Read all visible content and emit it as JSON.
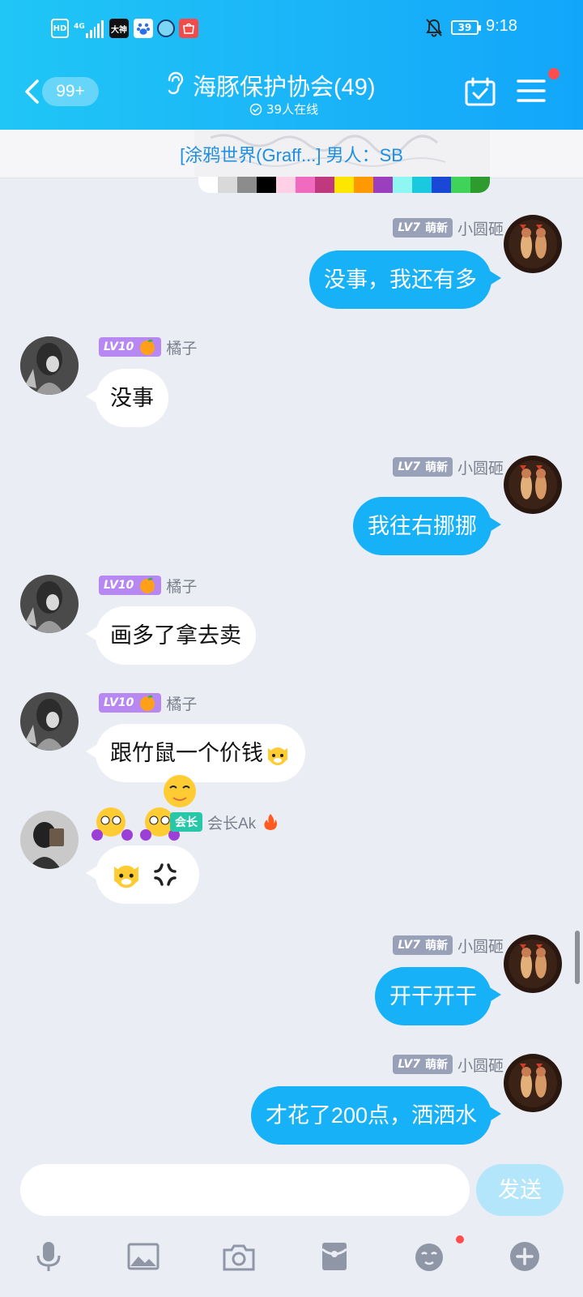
{
  "status_bar": {
    "hd": "HD",
    "network": "4G",
    "app_dashen": "大神",
    "battery": "39",
    "time": "9:18"
  },
  "header": {
    "unread_count": "99+",
    "group_title": "海豚保护协会(49)",
    "online_text": "39人在线"
  },
  "notice": {
    "text": "[涂鸦世界(Graff...] 男人：SB",
    "palette_colors": [
      "#ffffff",
      "#d9d9d9",
      "#8c8c8c",
      "#000000",
      "#ffd0e6",
      "#f06ac0",
      "#c0397f",
      "#ffe600",
      "#ff9900",
      "#9c3fbe",
      "#8ff7f1",
      "#1ac9e0",
      "#1a47d6",
      "#3fd35a",
      "#2e9b2e"
    ]
  },
  "messages": [
    {
      "side": "right",
      "level": "LV7",
      "tag": "萌新",
      "nickname": "小圆砸",
      "text": "没事，我还有多"
    },
    {
      "side": "left",
      "level": "LV10",
      "nickname": "橘子",
      "text": "没事"
    },
    {
      "side": "right",
      "level": "LV7",
      "tag": "萌新",
      "nickname": "小圆砸",
      "text": "我往右挪挪"
    },
    {
      "side": "left",
      "level": "LV10",
      "nickname": "橘子",
      "text": "画多了拿去卖"
    },
    {
      "side": "left",
      "level": "LV10",
      "nickname": "橘子",
      "text": "跟竹鼠一个价钱"
    },
    {
      "side": "left",
      "tag": "会长",
      "nickname": "会长Ak",
      "text": ""
    },
    {
      "side": "right",
      "level": "LV7",
      "tag": "萌新",
      "nickname": "小圆砸",
      "text": "开干开干"
    },
    {
      "side": "right",
      "level": "LV7",
      "tag": "萌新",
      "nickname": "小圆砸",
      "text": "才花了200点，洒洒水"
    }
  ],
  "input": {
    "value": "",
    "send_label": "发送"
  },
  "toolbar_icons": [
    "microphone-icon",
    "image-icon",
    "camera-icon",
    "red-packet-icon",
    "emoji-icon",
    "plus-icon"
  ],
  "colors": {
    "header_gradient_start": "#20c6f6",
    "header_gradient_end": "#12a6fa",
    "bubble_self": "#16b1f7",
    "bubble_other": "#ffffff",
    "background": "#ebedf5",
    "send_button": "#b3e6fb",
    "notice_text": "#1f8fe0"
  }
}
